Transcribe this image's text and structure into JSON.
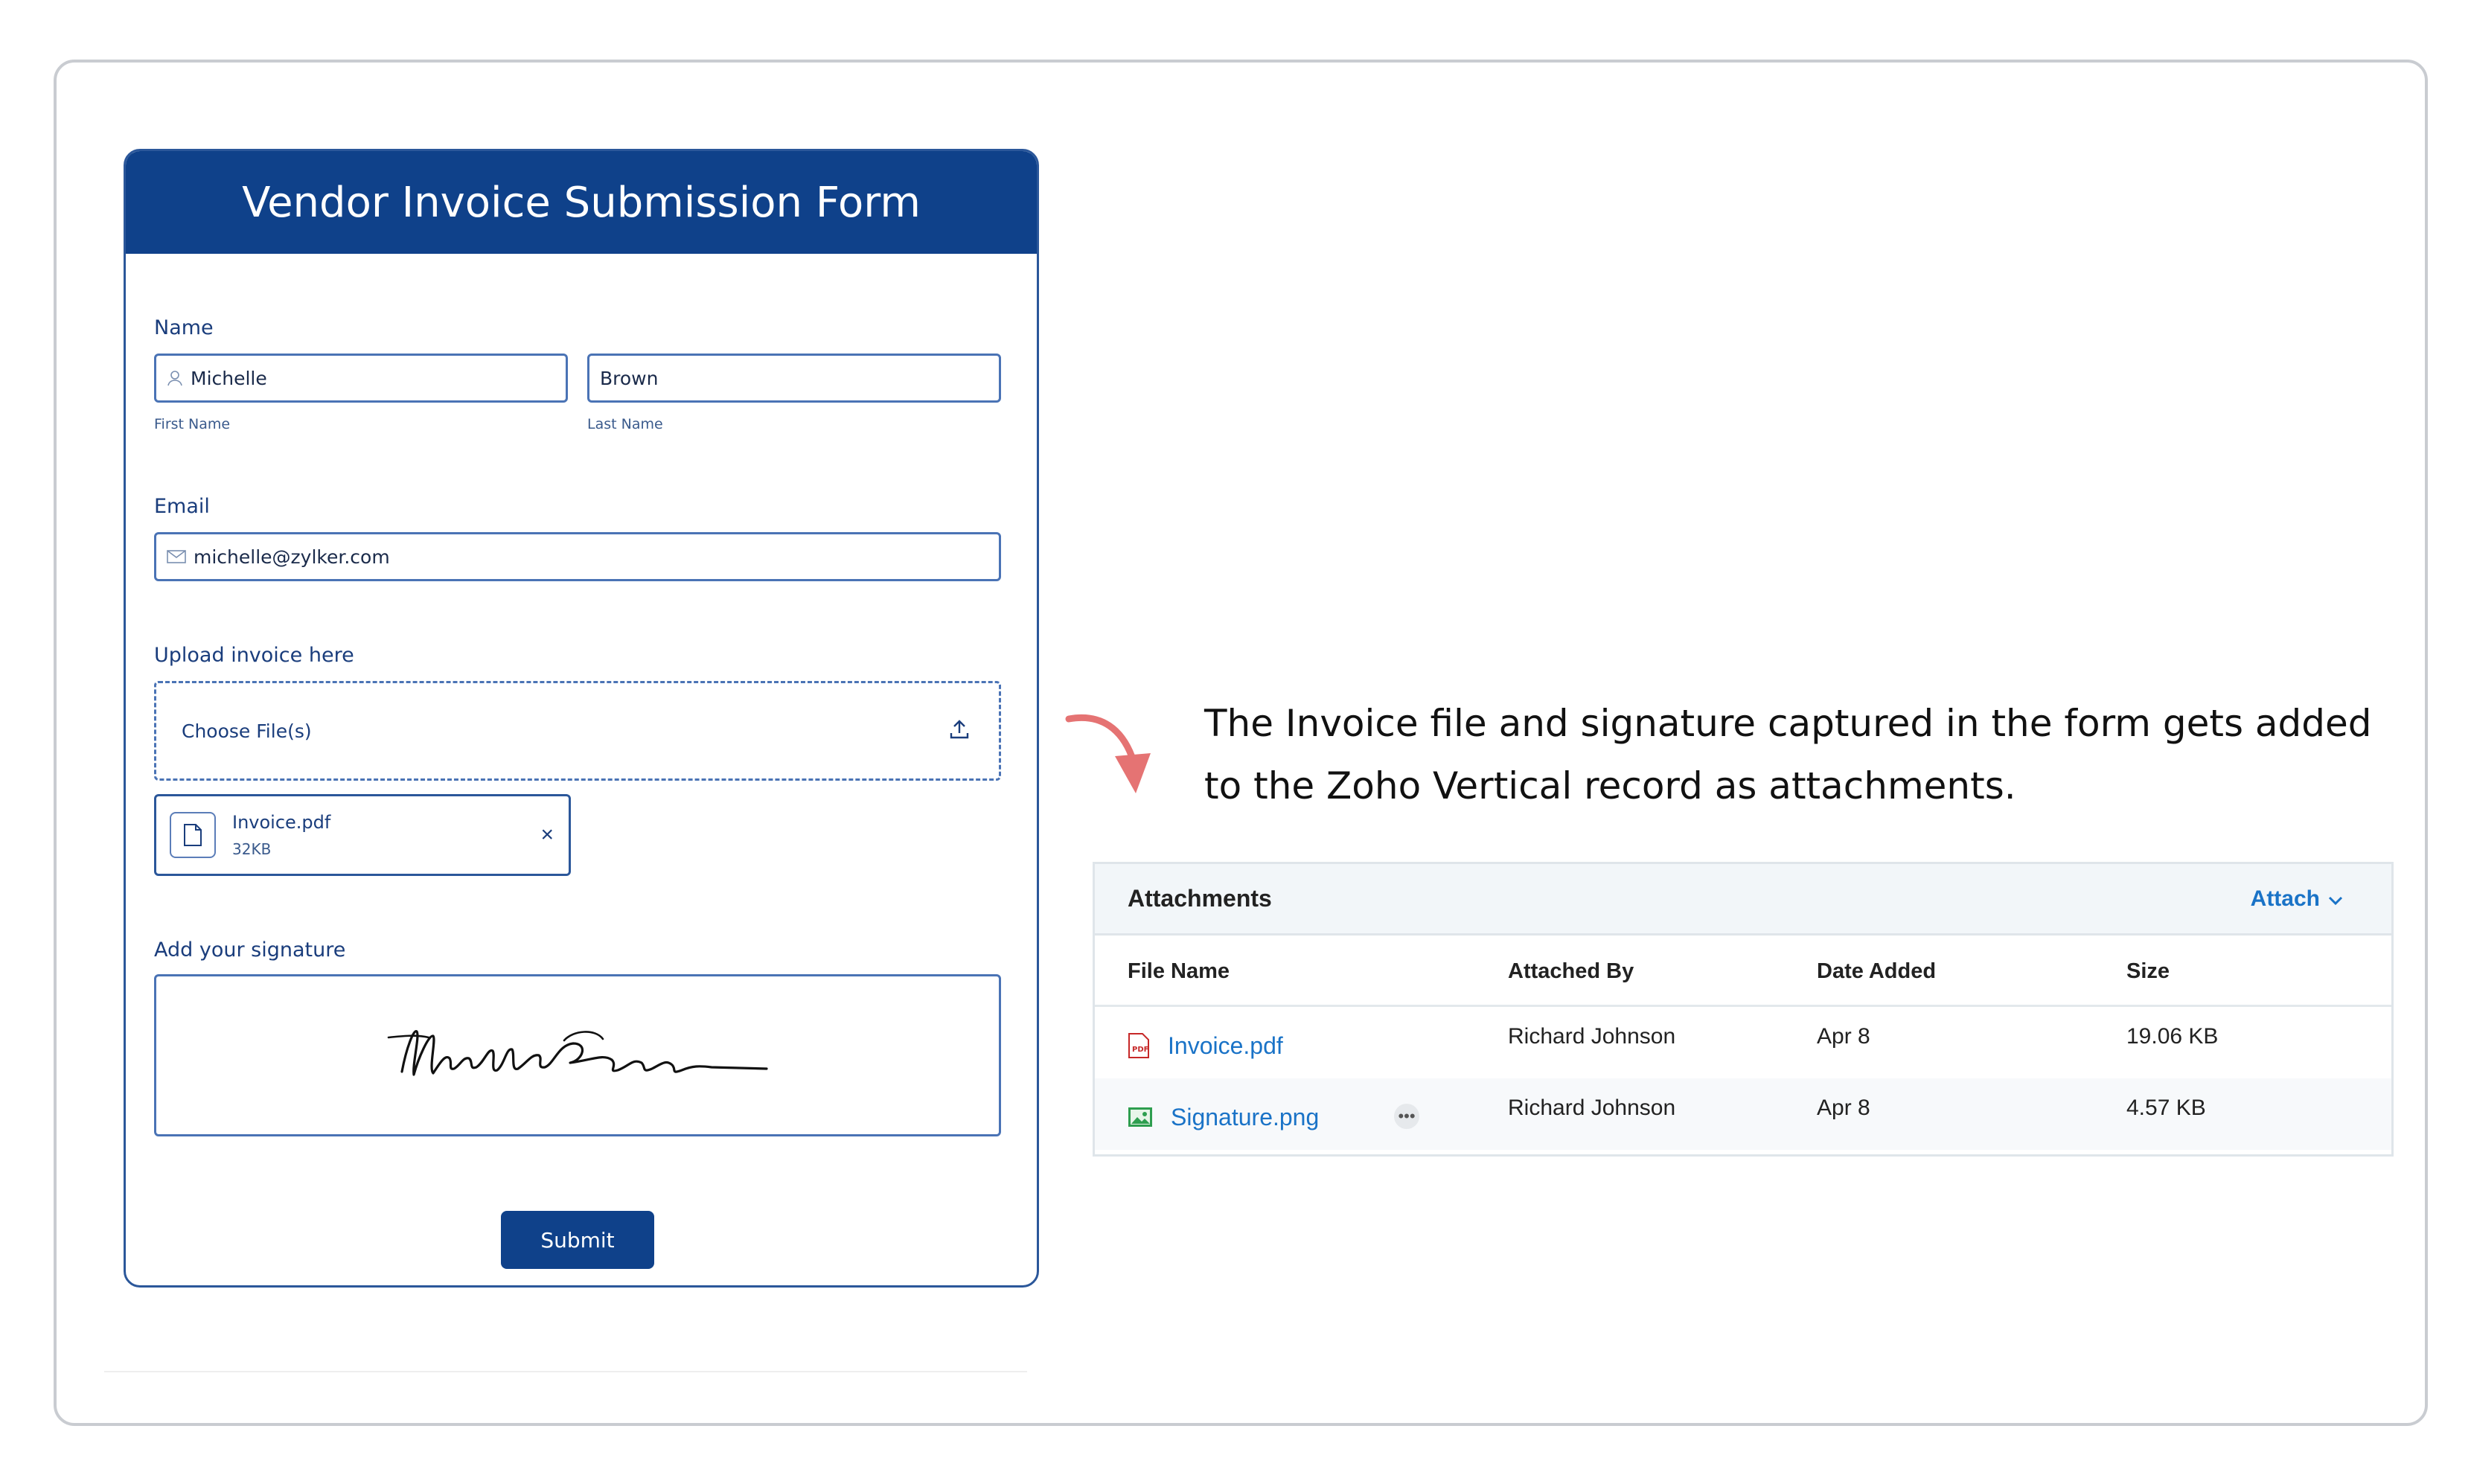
{
  "form": {
    "title": "Vendor Invoice Submission Form",
    "name_label": "Name",
    "first_name_value": "Michelle",
    "first_name_sublabel": "First Name",
    "last_name_value": "Brown",
    "last_name_sublabel": "Last Name",
    "email_label": "Email",
    "email_value": "michelle@zylker.com",
    "upload_label": "Upload invoice here",
    "choose_files": "Choose File(s)",
    "uploaded_file": {
      "name": "Invoice.pdf",
      "size": "32KB"
    },
    "signature_label": "Add your signature",
    "submit_label": "Submit",
    "accent": "#0f418a"
  },
  "caption": "The Invoice file and signature captured in the form gets added to the Zoho Vertical record as attachments.",
  "attachments": {
    "title": "Attachments",
    "attach_label": "Attach",
    "columns": [
      "File Name",
      "Attached By",
      "Date Added",
      "Size"
    ],
    "rows": [
      {
        "file": "Invoice.pdf",
        "icon": "pdf-file-icon",
        "by": "Richard Johnson",
        "date": "Apr 8",
        "size": "19.06 KB"
      },
      {
        "file": "Signature.png",
        "icon": "image-file-icon",
        "by": "Richard Johnson",
        "date": "Apr 8",
        "size": "4.57 KB"
      }
    ],
    "link_color": "#1a73c7"
  }
}
